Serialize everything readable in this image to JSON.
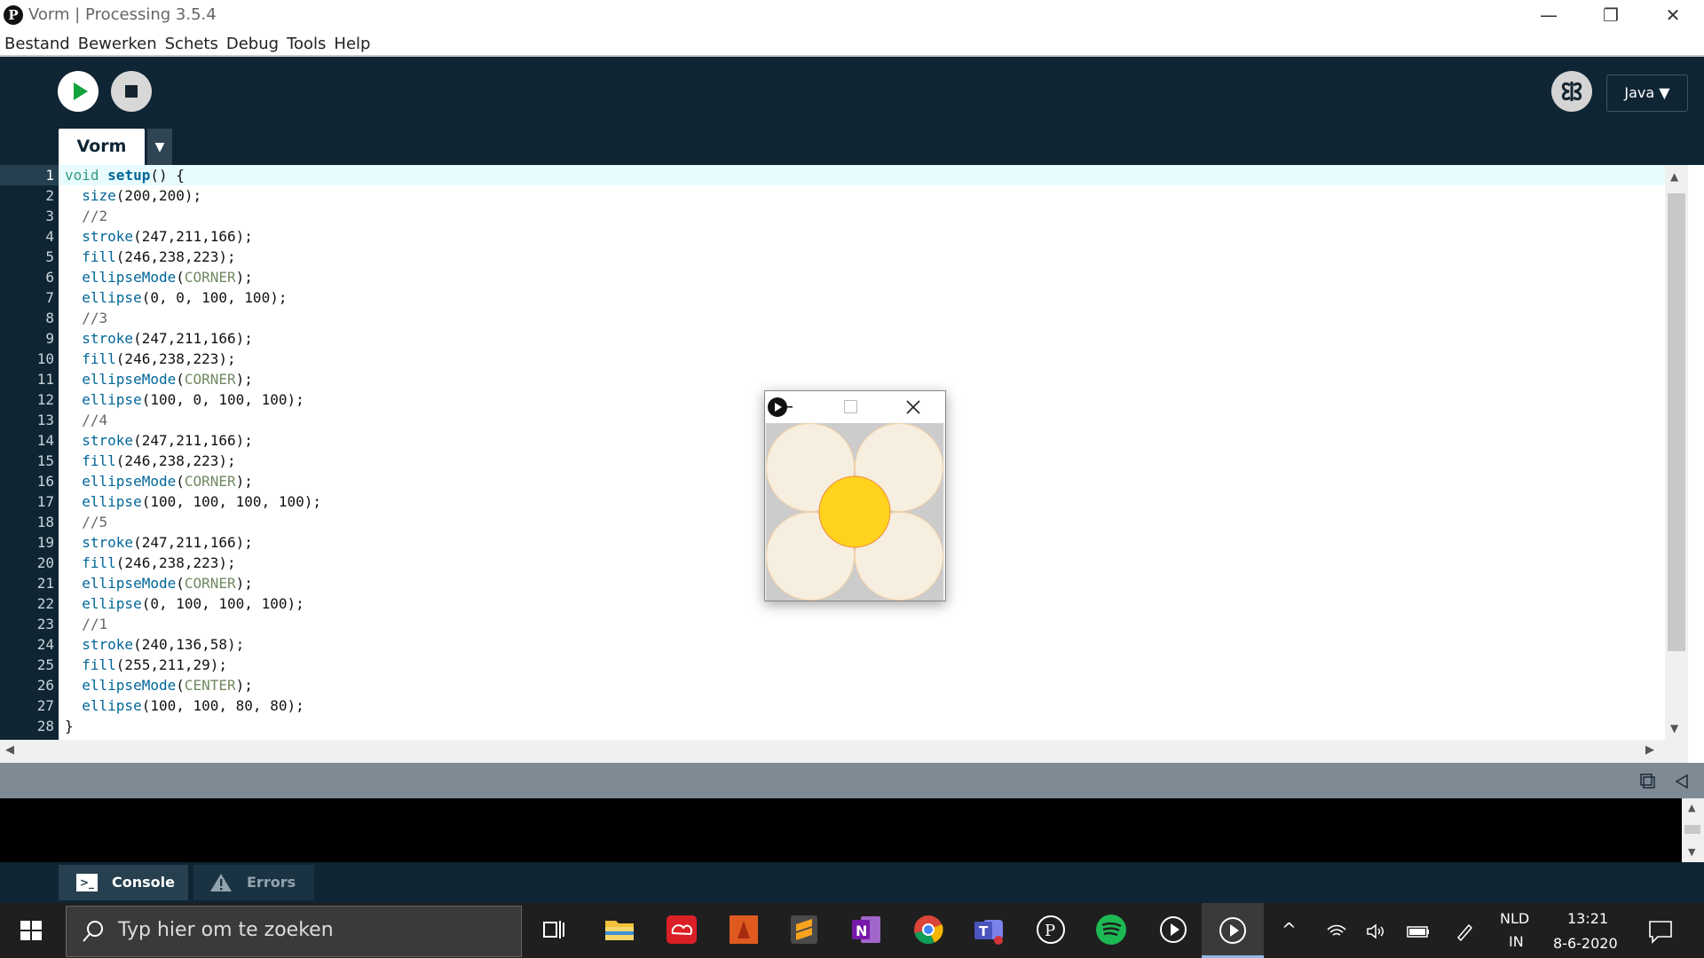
{
  "window": {
    "title": "Vorm | Processing 3.5.4",
    "controls": {
      "minimize": "—",
      "restore": "❐",
      "close": "✕"
    }
  },
  "menubar": [
    "Bestand",
    "Bewerken",
    "Schets",
    "Debug",
    "Tools",
    "Help"
  ],
  "toolbar": {
    "run_icon": "play-icon",
    "stop_icon": "stop-icon",
    "debug_icon": "debug-butterfly-icon",
    "mode": "Java ▼"
  },
  "tabs": {
    "active": "Vorm",
    "menu": "▼"
  },
  "editor": {
    "line_numbers": [
      "1",
      "2",
      "3",
      "4",
      "5",
      "6",
      "7",
      "8",
      "9",
      "10",
      "11",
      "12",
      "13",
      "14",
      "15",
      "16",
      "17",
      "18",
      "19",
      "20",
      "21",
      "22",
      "23",
      "24",
      "25",
      "26",
      "27",
      "28"
    ],
    "lines": [
      "void setup() {",
      "  size(200,200);",
      "  //2",
      "  stroke(247,211,166);",
      "  fill(246,238,223);",
      "  ellipseMode(CORNER);",
      "  ellipse(0, 0, 100, 100);",
      "  //3",
      "  stroke(247,211,166);",
      "  fill(246,238,223);",
      "  ellipseMode(CORNER);",
      "  ellipse(100, 0, 100, 100);",
      "  //4",
      "  stroke(247,211,166);",
      "  fill(246,238,223);",
      "  ellipseMode(CORNER);",
      "  ellipse(100, 100, 100, 100);",
      "  //5",
      "  stroke(247,211,166);",
      "  fill(246,238,223);",
      "  ellipseMode(CORNER);",
      "  ellipse(0, 100, 100, 100);",
      "  //1",
      "  stroke(240,136,58);",
      "  fill(255,211,29);",
      "  ellipseMode(CENTER);",
      "  ellipse(100, 100, 80, 80);",
      "}"
    ]
  },
  "sketch": {
    "petal_fill": "#f6eedf",
    "petal_stroke": "#f7d3a6",
    "center_fill": "#ffd31d",
    "center_stroke": "#f0883a",
    "background": "#cccccc"
  },
  "console_tabs": {
    "console": "Console",
    "errors": "Errors"
  },
  "taskbar": {
    "search_placeholder": "Typ hier om te zoeken",
    "language": "NLD",
    "input_mode": "IN",
    "time": "13:21",
    "date": "8-6-2020"
  }
}
